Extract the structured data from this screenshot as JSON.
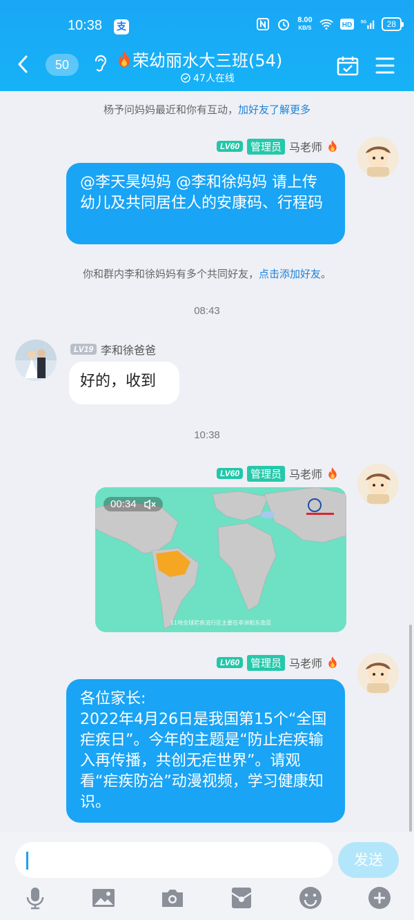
{
  "status_bar": {
    "time": "10:38",
    "pay_icon": "支",
    "net_speed_value": "8.00",
    "net_speed_unit": "KB/S",
    "battery": "28"
  },
  "header": {
    "unread_count": "50",
    "group_name": "荣幼丽水大三班(54)",
    "online_count": "47人在线"
  },
  "notes": {
    "n1_text": "杨予问妈妈最近和你有互动，",
    "n1_link": "加好友了解更多",
    "n2_text": "你和群内李和徐妈妈有多个共同好友，",
    "n2_link": "点击添加好友",
    "n2_end": "。"
  },
  "messages": [
    {
      "sender": "马老师",
      "level": "LV60",
      "role": "管理员",
      "text": "@李天昊妈妈 @李和徐妈妈 请上传幼儿及共同居住人的安康码、行程码"
    },
    {
      "time": "08:43"
    },
    {
      "sender": "李和徐爸爸",
      "level": "LV19",
      "text": "好的，收到"
    },
    {
      "time": "10:38"
    },
    {
      "sender": "马老师",
      "level": "LV60",
      "role": "管理员",
      "video_duration": "00:34"
    },
    {
      "sender": "马老师",
      "level": "LV60",
      "role": "管理员",
      "text": "各位家长:\n2022年4月26日是我国第15个“全国疟疾日”。今年的主题是“防止疟疾输入再传播，共创无疟世界”。请观看“疟疾防治”动漫视频，学习健康知识。"
    }
  ],
  "video_caption": "11地全球疟疾流行区主要在非洲和东南亚",
  "input": {
    "placeholder": "",
    "send_label": "发送"
  },
  "icons": [
    "back-icon",
    "ear-icon",
    "calendar-icon",
    "menu-icon",
    "mic-icon",
    "image-icon",
    "camera-icon",
    "red-packet-icon",
    "emoji-icon",
    "plus-icon"
  ],
  "colors": {
    "primary": "#19a4f5",
    "admin_tag": "#26c8aa",
    "link": "#1f82d8"
  }
}
